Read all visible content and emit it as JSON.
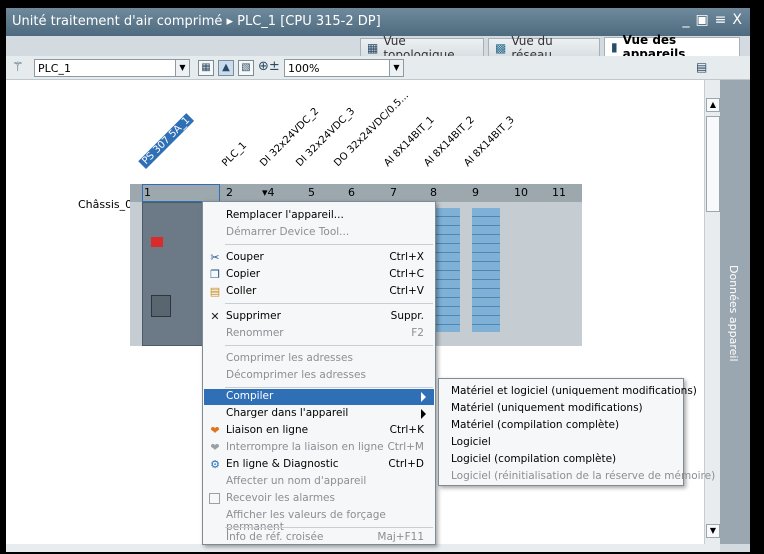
{
  "window": {
    "title": "Unité traitement d'air comprimé  ▸  PLC_1 [CPU 315-2 DP]",
    "controls": [
      "_",
      "▣",
      "≡",
      "X"
    ]
  },
  "tabs": [
    {
      "label": "Vue topologique",
      "icon": "topology-icon"
    },
    {
      "label": "Vue du réseau",
      "icon": "network-icon"
    },
    {
      "label": "Vue des appareils",
      "icon": "device-icon",
      "active": true
    }
  ],
  "toolbar": {
    "device_select": "PLC_1",
    "zoom": "100%"
  },
  "side_panel": {
    "label": "Données appareil"
  },
  "rack": {
    "name": "Châssis_0",
    "slots": [
      "1",
      "2",
      "▾4",
      "5",
      "6",
      "7",
      "8",
      "9",
      "10",
      "11"
    ],
    "modules": [
      "PS 307 5A_1",
      "PLC_1",
      "DI 32x24VDC_2",
      "DI 32x24VDC_3",
      "DO 32x24VDC/0.5...",
      "AI 8X14BIT_1",
      "AI 8X14BIT_2",
      "AI 8X14BIT_3"
    ]
  },
  "context_menu": {
    "items": [
      {
        "label": "Remplacer l'appareil...",
        "shortcut": "",
        "disabled": false,
        "icon": ""
      },
      {
        "label": "Démarrer Device Tool...",
        "shortcut": "",
        "disabled": true,
        "icon": ""
      },
      {
        "label": "Couper",
        "shortcut": "Ctrl+X",
        "disabled": false,
        "icon": "cut-icon"
      },
      {
        "label": "Copier",
        "shortcut": "Ctrl+C",
        "disabled": false,
        "icon": "copy-icon"
      },
      {
        "label": "Coller",
        "shortcut": "Ctrl+V",
        "disabled": false,
        "icon": "paste-icon"
      },
      {
        "label": "Supprimer",
        "shortcut": "Suppr.",
        "disabled": false,
        "icon": "delete-icon"
      },
      {
        "label": "Renommer",
        "shortcut": "F2",
        "disabled": true,
        "icon": ""
      },
      {
        "label": "Comprimer les adresses",
        "shortcut": "",
        "disabled": true,
        "icon": ""
      },
      {
        "label": "Décomprimer les adresses",
        "shortcut": "",
        "disabled": true,
        "icon": ""
      },
      {
        "label": "Compiler",
        "shortcut": "",
        "disabled": false,
        "icon": "",
        "highlighted": true,
        "submenu": true
      },
      {
        "label": "Charger dans l'appareil",
        "shortcut": "",
        "disabled": false,
        "icon": "",
        "submenu": true
      },
      {
        "label": "Liaison en ligne",
        "shortcut": "Ctrl+K",
        "disabled": false,
        "icon": "go-online-icon"
      },
      {
        "label": "Interrompre la liaison en ligne",
        "shortcut": "Ctrl+M",
        "disabled": true,
        "icon": "go-offline-icon"
      },
      {
        "label": "En ligne & Diagnostic",
        "shortcut": "Ctrl+D",
        "disabled": false,
        "icon": "diagnostic-icon"
      },
      {
        "label": "Affecter un nom d'appareil",
        "shortcut": "",
        "disabled": true,
        "icon": ""
      },
      {
        "label": "Recevoir les alarmes",
        "shortcut": "",
        "disabled": true,
        "icon": "alarm-icon"
      },
      {
        "label": "Afficher les valeurs de forçage permanent",
        "shortcut": "",
        "disabled": true,
        "icon": ""
      },
      {
        "label": "Info de réf. croisée",
        "shortcut": "Maj+F11",
        "disabled": true,
        "icon": ""
      }
    ]
  },
  "compile_submenu": {
    "items": [
      {
        "label": "Matériel et logiciel (uniquement modifications)",
        "disabled": false
      },
      {
        "label": "Matériel (uniquement modifications)",
        "disabled": false
      },
      {
        "label": "Matériel (compilation complète)",
        "disabled": false
      },
      {
        "label": "Logiciel",
        "disabled": false
      },
      {
        "label": "Logiciel (compilation complète)",
        "disabled": false
      },
      {
        "label": "Logiciel (réinitialisation de la réserve de mémoire)",
        "disabled": true
      }
    ]
  }
}
